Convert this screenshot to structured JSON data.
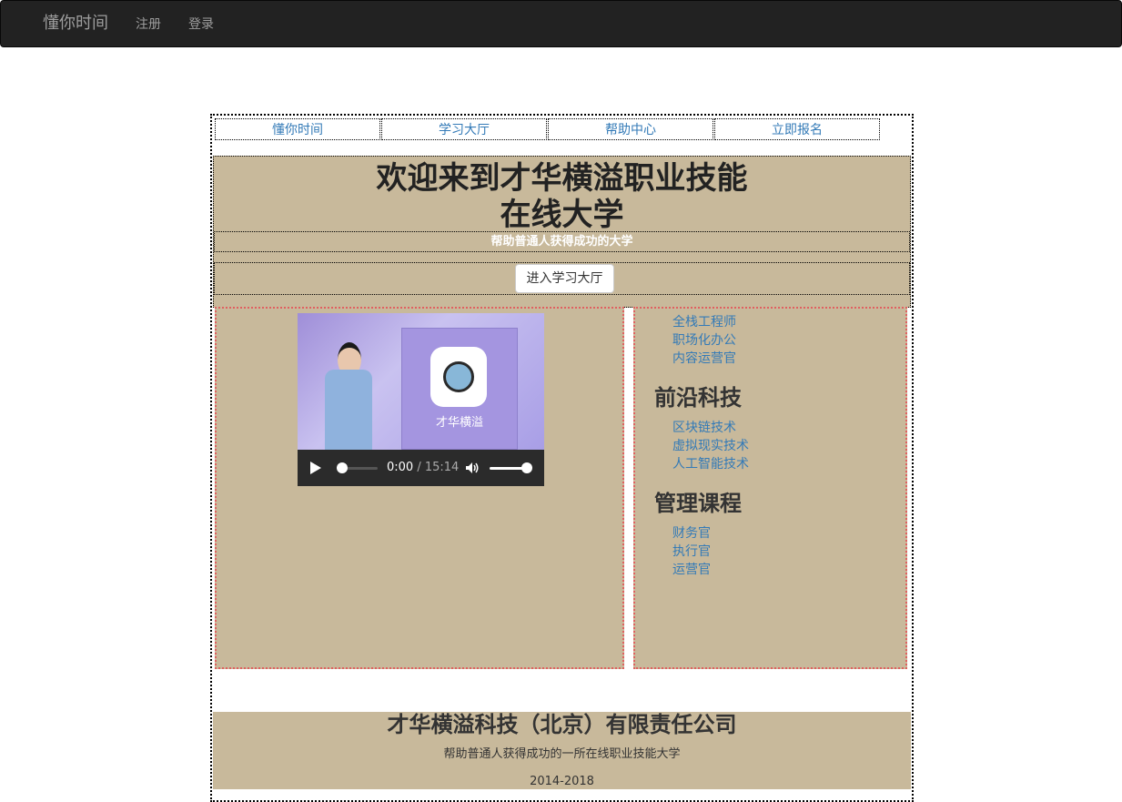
{
  "navbar": {
    "brand": "懂你时间",
    "links": [
      "注册",
      "登录"
    ]
  },
  "topnav": {
    "tabs": [
      "懂你时间",
      "学习大厅",
      "帮助中心",
      "立即报名"
    ]
  },
  "hero": {
    "title_line1": "欢迎来到才华横溢职业技能",
    "title_line2": "在线大学",
    "subtitle": "帮助普通人获得成功的大学",
    "button_label": "进入学习大厅"
  },
  "video": {
    "screen_text": "才华横溢",
    "current_time": "0:00",
    "duration": "/ 15:14",
    "progress": 0,
    "volume": 1
  },
  "courses": {
    "group1_items": [
      "全栈工程师",
      "职场化办公",
      "内容运营官"
    ],
    "group2_title": "前沿科技",
    "group2_items": [
      "区块链技术",
      "虚拟现实技术",
      "人工智能技术"
    ],
    "group3_title": "管理课程",
    "group3_items": [
      "财务官",
      "执行官",
      "运营官"
    ]
  },
  "footer": {
    "company": "才华横溢科技（北京）有限责任公司",
    "tagline": "帮助普通人获得成功的一所在线职业技能大学",
    "years": "2014-2018"
  },
  "colors": {
    "navbar_bg": "#222222",
    "panel_bg": "#c8b99b",
    "link": "#337ab7"
  }
}
